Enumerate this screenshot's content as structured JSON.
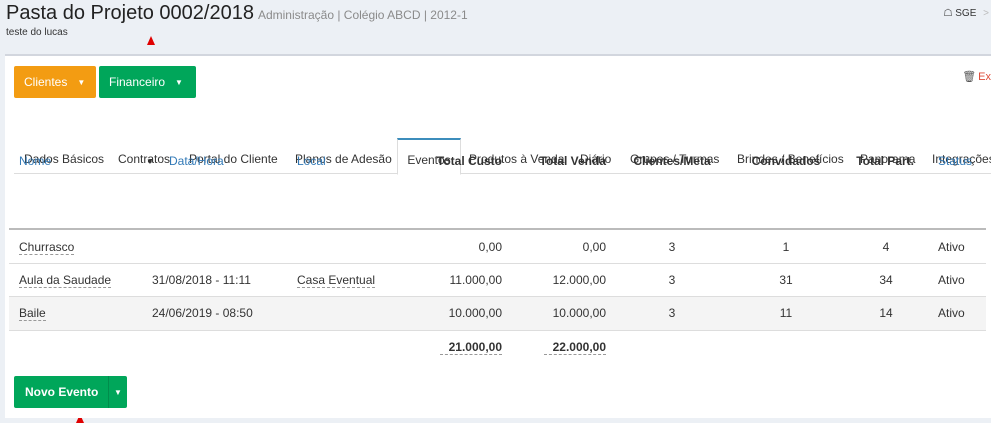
{
  "header": {
    "title": "Pasta do Projeto 0002/2018",
    "title_meta": "Administração | Colégio ABCD | 2012-1",
    "subtitle": "teste do lucas",
    "breadcrumb": "SGE"
  },
  "toolbar": {
    "clientes_label": "Clientes",
    "financeiro_label": "Financeiro",
    "delete_label": "Ex"
  },
  "tabs": [
    {
      "label": "Dados Básicos"
    },
    {
      "label": "Contratos"
    },
    {
      "label": "Portal do Cliente"
    },
    {
      "label": "Planos de Adesão"
    },
    {
      "label": "Eventos"
    },
    {
      "label": "Produtos à Venda"
    },
    {
      "label": "Diário"
    },
    {
      "label": "Grupos / Turmas"
    },
    {
      "label": "Brindes / Benefícios"
    },
    {
      "label": "Panorama"
    },
    {
      "label": "Integrações"
    }
  ],
  "table": {
    "headers": {
      "nome": "Nome",
      "data_hora": "Data/Hora",
      "local": "Local",
      "total_custo": "Total Custo",
      "total_venda": "Total Venda",
      "clientes_meta": "Clientes/Meta",
      "convidados": "Convidados",
      "total_part": "Total Part.",
      "status": "Status"
    },
    "rows": [
      {
        "nome": "Churrasco",
        "data_hora": "",
        "local": "",
        "total_custo": "0,00",
        "total_venda": "0,00",
        "clientes_meta": "3",
        "convidados": "1",
        "total_part": "4",
        "status": "Ativo"
      },
      {
        "nome": "Aula da Saudade",
        "data_hora": "31/08/2018 - 11:11",
        "local": "Casa Eventual",
        "total_custo": "11.000,00",
        "total_venda": "12.000,00",
        "clientes_meta": "3",
        "convidados": "31",
        "total_part": "34",
        "status": "Ativo"
      },
      {
        "nome": "Baile",
        "data_hora": "24/06/2019 - 08:50",
        "local": "",
        "total_custo": "10.000,00",
        "total_venda": "10.000,00",
        "clientes_meta": "3",
        "convidados": "11",
        "total_part": "14",
        "status": "Ativo"
      }
    ],
    "totals": {
      "total_custo": "21.000,00",
      "total_venda": "22.000,00"
    }
  },
  "actions": {
    "novo_evento_label": "Novo Evento"
  },
  "colors": {
    "orange": "#f39c12",
    "green": "#00a65a",
    "link_blue": "#337ab7",
    "annotation_red": "#e00000"
  }
}
